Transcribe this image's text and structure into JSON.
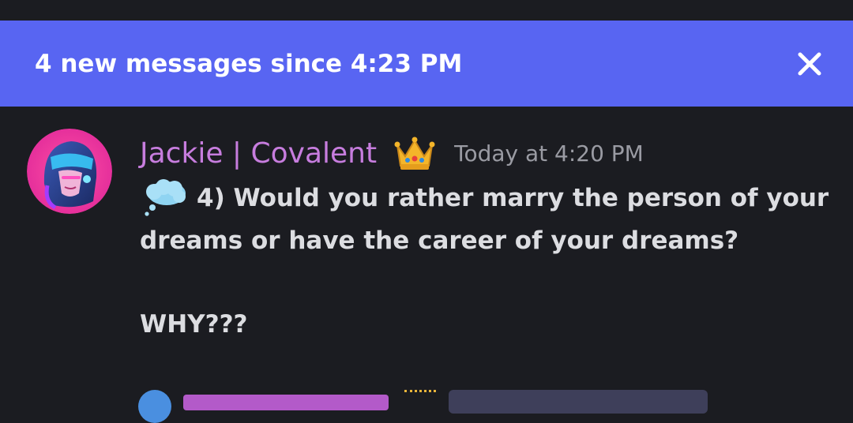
{
  "banner": {
    "text": "4 new messages since 4:23 PM",
    "close_icon": "close-icon",
    "background": "#5865f2"
  },
  "message": {
    "username": "Jackie | Covalent",
    "username_color": "#c77dde",
    "badge_icon": "crown-icon",
    "timestamp": "Today at 4:20 PM",
    "emoji_icon": "thought-balloon-icon",
    "line1": "4) Would you rather marry the person of your",
    "line2": "dreams or have the career of your dreams?",
    "line3": "WHY???"
  }
}
